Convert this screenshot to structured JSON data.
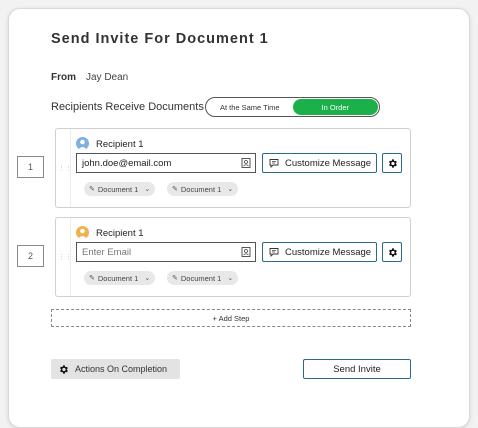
{
  "title": "Send Invite For Document 1",
  "from": {
    "label": "From",
    "value": "Jay Dean"
  },
  "recipients_mode": {
    "label": "Recipients Receive Documents",
    "options": [
      "At the Same Time",
      "In Order"
    ],
    "selected": "In Order"
  },
  "steps": [
    {
      "number": "1",
      "recipient_label": "Recipient 1",
      "avatar_color": "#7fb0e0",
      "email_value": "john.doe@email.com",
      "email_placeholder": "Enter Email",
      "customize_label": "Customize Message",
      "documents": [
        "Document 1",
        "Document 1"
      ]
    },
    {
      "number": "2",
      "recipient_label": "Recipient 1",
      "avatar_color": "#f0b050",
      "email_value": "",
      "email_placeholder": "Enter Email",
      "customize_label": "Customize Message",
      "documents": [
        "Document 1",
        "Document 1"
      ]
    }
  ],
  "add_step_label": "+ Add Step",
  "actions_label": "Actions On Completion",
  "send_label": "Send Invite",
  "colors": {
    "accent_green": "#1bb04a",
    "button_border": "#2a6a8a"
  }
}
